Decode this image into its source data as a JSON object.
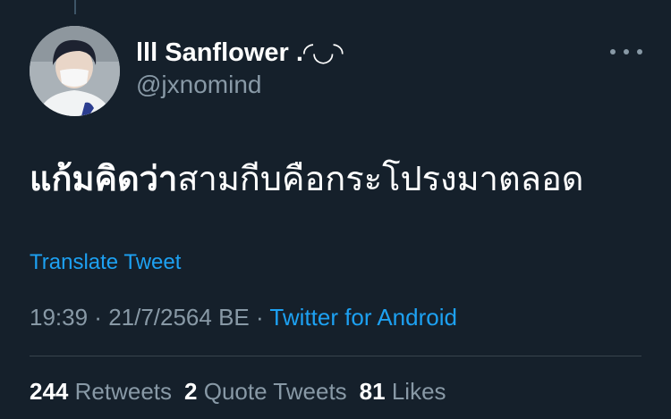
{
  "user": {
    "display_name": "lll Sanflower .◜◡◝",
    "username": "@jxnomind"
  },
  "tweet": {
    "text_bold": "แก้มคิดว่า",
    "text_rest": "สามกีบคือกระโปรงมาตลอด"
  },
  "translate_label": "Translate Tweet",
  "meta": {
    "time": "19:39",
    "separator1": " · ",
    "date": "21/7/2564 BE",
    "separator2": " · ",
    "source": "Twitter for Android"
  },
  "stats": {
    "retweets_count": "244",
    "retweets_label": "Retweets",
    "quotes_count": "2",
    "quotes_label": "Quote Tweets",
    "likes_count": "81",
    "likes_label": "Likes"
  },
  "icons": {
    "more": "more-horizontal-icon"
  },
  "colors": {
    "background": "#15202b",
    "primary_text": "#ffffff",
    "secondary_text": "#8899a6",
    "accent": "#1da1f2",
    "divider": "#38444d"
  }
}
